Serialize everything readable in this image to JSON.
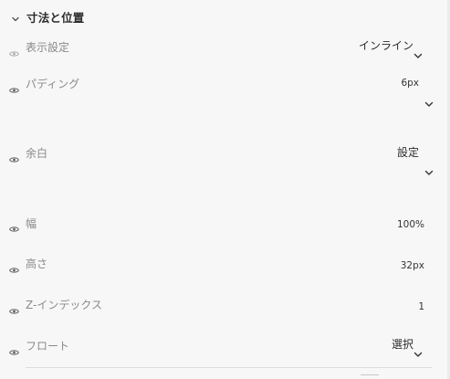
{
  "panel": {
    "section_title": "寸法と位置",
    "rows": [
      {
        "label": "表示設定",
        "value": "インライン",
        "has_dropdown": true
      },
      {
        "label": "パディング",
        "value": "6px",
        "has_dropdown": true
      },
      {
        "label": "余白",
        "value": "設定",
        "has_dropdown": true
      },
      {
        "label": "幅",
        "value": "100%",
        "has_dropdown": false
      },
      {
        "label": "高さ",
        "value": "32px",
        "has_dropdown": false
      },
      {
        "label": "Z-インデックス",
        "value": "1",
        "has_dropdown": false
      },
      {
        "label": "フロート",
        "value": "選択",
        "has_dropdown": true
      }
    ]
  },
  "icons": {
    "section_toggle": "chevron-down-icon",
    "visibility": "eye-icon",
    "dropdown": "chevron-down-icon"
  },
  "colors": {
    "background": "#f7f7f7",
    "text": "#3a3a3a",
    "muted": "#8a8a8a"
  }
}
